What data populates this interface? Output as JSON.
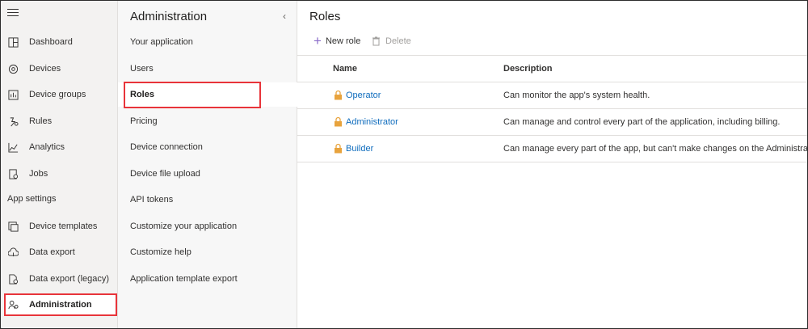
{
  "leftnav": {
    "items": [
      {
        "label": "Dashboard",
        "icon": "dashboard-icon"
      },
      {
        "label": "Devices",
        "icon": "devices-icon"
      },
      {
        "label": "Device groups",
        "icon": "device-groups-icon"
      },
      {
        "label": "Rules",
        "icon": "rules-icon"
      },
      {
        "label": "Analytics",
        "icon": "analytics-icon"
      },
      {
        "label": "Jobs",
        "icon": "jobs-icon"
      }
    ],
    "section_label": "App settings",
    "settings_items": [
      {
        "label": "Device templates",
        "icon": "device-templates-icon"
      },
      {
        "label": "Data export",
        "icon": "data-export-icon"
      },
      {
        "label": "Data export (legacy)",
        "icon": "data-export-legacy-icon"
      },
      {
        "label": "Administration",
        "icon": "administration-icon",
        "selected": true
      }
    ]
  },
  "admin": {
    "title": "Administration",
    "items": [
      {
        "label": "Your application"
      },
      {
        "label": "Users"
      },
      {
        "label": "Roles",
        "selected": true
      },
      {
        "label": "Pricing"
      },
      {
        "label": "Device connection"
      },
      {
        "label": "Device file upload"
      },
      {
        "label": "API tokens"
      },
      {
        "label": "Customize your application"
      },
      {
        "label": "Customize help"
      },
      {
        "label": "Application template export"
      }
    ]
  },
  "main": {
    "title": "Roles",
    "commands": {
      "new_role": "New role",
      "delete": "Delete"
    },
    "columns": {
      "name": "Name",
      "description": "Description"
    },
    "rows": [
      {
        "name": "Operator",
        "description": "Can monitor the app's system health."
      },
      {
        "name": "Administrator",
        "description": "Can manage and control every part of the application, including billing."
      },
      {
        "name": "Builder",
        "description": "Can manage every part of the app, but can't make changes on the Administration o"
      }
    ]
  },
  "colors": {
    "highlight_box": "#e8343a",
    "link": "#0f6cbd",
    "lock": "#e8a33d",
    "accent_plus": "#8a6cc9",
    "top_stripe": "#4b2a6e"
  }
}
